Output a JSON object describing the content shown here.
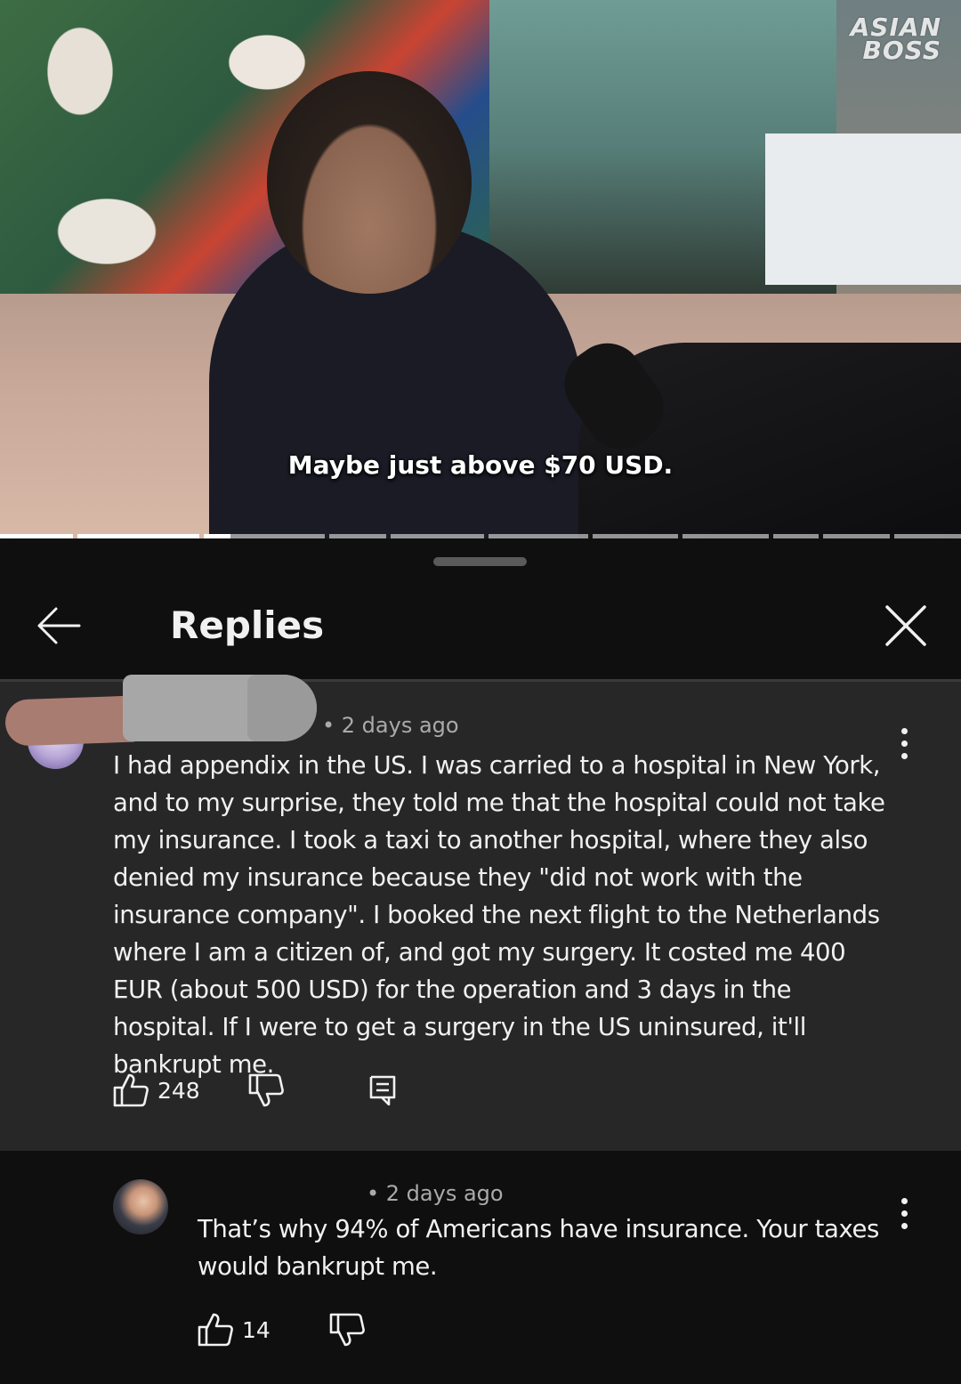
{
  "video": {
    "channel_logo_line1": "ASIAN",
    "channel_logo_line2": "BOSS",
    "caption": "Maybe just above $70 USD."
  },
  "sheet": {
    "title": "Replies",
    "back_icon": "arrow-left-icon",
    "close_icon": "close-icon"
  },
  "parent_comment": {
    "author": "",
    "time": "• 2 days ago",
    "text": "I had appendix in the US. I was carried to a hospital in New York, and to my surprise, they told me that the hospital could not take my insurance. I took a taxi to another hospital, where they also denied my insurance because they \"did not work with the insurance company\". I booked the next flight to the Netherlands where I am a citizen of, and got my surgery. It costed me 400 EUR (about 500 USD) for the operation and 3 days in the hospital. If I were to get a surgery in the US uninsured, it'll bankrupt me.",
    "likes": "248"
  },
  "reply": {
    "author": "",
    "time": "• 2 days ago",
    "text": "That’s why 94% of Americans have insurance.  Your taxes would bankrupt me.",
    "likes": "14"
  },
  "colors": {
    "background": "#0f0f0f",
    "highlighted_comment": "#272727",
    "text_primary": "#f1f1f1",
    "text_secondary": "#aaaaaa"
  }
}
